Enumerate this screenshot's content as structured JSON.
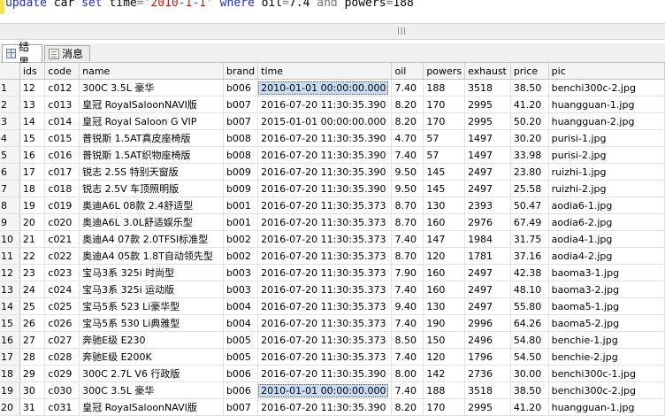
{
  "query": {
    "kw_update": "update",
    "table_name": "car",
    "kw_set": "set",
    "set_column": "time",
    "eq1": "=",
    "set_value": "'2010-1-1'",
    "kw_where": "where",
    "cond1_column": "oil",
    "eq2": "=",
    "cond1_value": "7.4",
    "kw_and": "and",
    "cond2_column": "powers",
    "eq3": "=",
    "cond2_value": "188"
  },
  "tabs": [
    {
      "label": "结果",
      "icon": "grid-icon",
      "active": true
    },
    {
      "label": "消息",
      "icon": "message-icon",
      "active": false
    }
  ],
  "columns": [
    "",
    "ids",
    "code",
    "name",
    "brand",
    "time",
    "oil",
    "powers",
    "exhaust",
    "price",
    "pic"
  ],
  "rows": [
    [
      "1",
      "12",
      "c012",
      "300C 3.5L 豪华",
      "b006",
      "2010-01-01 00:00:00.000",
      "7.40",
      "188",
      "3518",
      "38.50",
      "benchi300c-2.jpg"
    ],
    [
      "2",
      "13",
      "c013",
      "皇冠 RoyalSaloonNAVI版",
      "b007",
      "2016-07-20 11:30:35.390",
      "8.20",
      "170",
      "2995",
      "41.20",
      "huangguan-1.jpg"
    ],
    [
      "3",
      "14",
      "c014",
      "皇冠 Royal Saloon G VIP",
      "b007",
      "2015-01-01 00:00:00.000",
      "8.20",
      "170",
      "2995",
      "50.20",
      "huangguan-2.jpg"
    ],
    [
      "4",
      "15",
      "c015",
      "普锐斯 1.5AT真皮座椅版",
      "b008",
      "2016-07-20 11:30:35.390",
      "4.70",
      "57",
      "1497",
      "30.20",
      "purisi-1.jpg"
    ],
    [
      "5",
      "16",
      "c016",
      "普锐斯 1.5AT织物座椅版",
      "b008",
      "2016-07-20 11:30:35.390",
      "7.40",
      "57",
      "1497",
      "33.98",
      "purisi-2.jpg"
    ],
    [
      "6",
      "17",
      "c017",
      "锐志 2.5S 特别天窗版",
      "b009",
      "2016-07-20 11:30:35.390",
      "9.50",
      "145",
      "2497",
      "23.80",
      "ruizhi-1.jpg"
    ],
    [
      "7",
      "18",
      "c018",
      "锐志 2.5V 车顶照明版",
      "b009",
      "2016-07-20 11:30:35.390",
      "9.50",
      "145",
      "2497",
      "25.58",
      "ruizhi-2.jpg"
    ],
    [
      "8",
      "19",
      "c019",
      "奥迪A6L 08款 2.4舒适型",
      "b001",
      "2016-07-20 11:30:35.373",
      "8.70",
      "130",
      "2393",
      "50.47",
      "aodia6-1.jpg"
    ],
    [
      "9",
      "20",
      "c020",
      "奥迪A6L 3.0L舒适娱乐型",
      "b001",
      "2016-07-20 11:30:35.373",
      "8.70",
      "160",
      "2976",
      "67.49",
      "aodia6-2.jpg"
    ],
    [
      "10",
      "21",
      "c021",
      "奥迪A4 07款 2.0TFSI标准型",
      "b002",
      "2016-07-20 11:30:35.373",
      "7.40",
      "147",
      "1984",
      "31.75",
      "aodia4-1.jpg"
    ],
    [
      "11",
      "22",
      "c022",
      "奥迪A4 05款 1.8T自动领先型",
      "b002",
      "2016-07-20 11:30:35.373",
      "8.70",
      "120",
      "1781",
      "37.16",
      "aodia4-2.jpg"
    ],
    [
      "12",
      "23",
      "c023",
      "宝马3系 325i 时尚型",
      "b003",
      "2016-07-20 11:30:35.373",
      "7.90",
      "160",
      "2497",
      "42.38",
      "baoma3-1.jpg"
    ],
    [
      "13",
      "24",
      "c024",
      "宝马3系 325i 运动版",
      "b003",
      "2016-07-20 11:30:35.373",
      "7.40",
      "160",
      "2497",
      "48.10",
      "baoma3-2.jpg"
    ],
    [
      "14",
      "25",
      "c025",
      "宝马5系 523 Li豪华型",
      "b004",
      "2016-07-20 11:30:35.373",
      "9.40",
      "130",
      "2497",
      "55.80",
      "baoma5-1.jpg"
    ],
    [
      "15",
      "26",
      "c026",
      "宝马5系 530 Li典雅型",
      "b004",
      "2016-07-20 11:30:35.373",
      "7.40",
      "190",
      "2996",
      "64.26",
      "baoma5-2.jpg"
    ],
    [
      "16",
      "27",
      "c027",
      "奔驰E级 E230",
      "b005",
      "2016-07-20 11:30:35.373",
      "8.50",
      "150",
      "2496",
      "54.80",
      "benchie-1.jpg"
    ],
    [
      "17",
      "28",
      "c028",
      "奔驰E级 E200K",
      "b005",
      "2016-07-20 11:30:35.373",
      "7.40",
      "120",
      "1796",
      "54.50",
      "benchie-2.jpg"
    ],
    [
      "18",
      "29",
      "c029",
      "300C 2.7L V6 行政版",
      "b006",
      "2016-07-20 11:30:35.390",
      "8.00",
      "142",
      "2736",
      "30.00",
      "benchi300c-1.jpg"
    ],
    [
      "19",
      "30",
      "c030",
      "300C 3.5L 豪华",
      "b006",
      "2010-01-01 00:00:00.000",
      "7.40",
      "188",
      "3518",
      "38.50",
      "benchi300c-2.jpg"
    ],
    [
      "20",
      "31",
      "c031",
      "皇冠 RoyalSaloonNAVI版",
      "b007",
      "2016-07-20 11:30:35.390",
      "8.20",
      "170",
      "2995",
      "41.20",
      "huangguan-1.jpg"
    ]
  ],
  "selected_cells": [
    [
      0,
      5
    ],
    [
      18,
      5
    ]
  ]
}
